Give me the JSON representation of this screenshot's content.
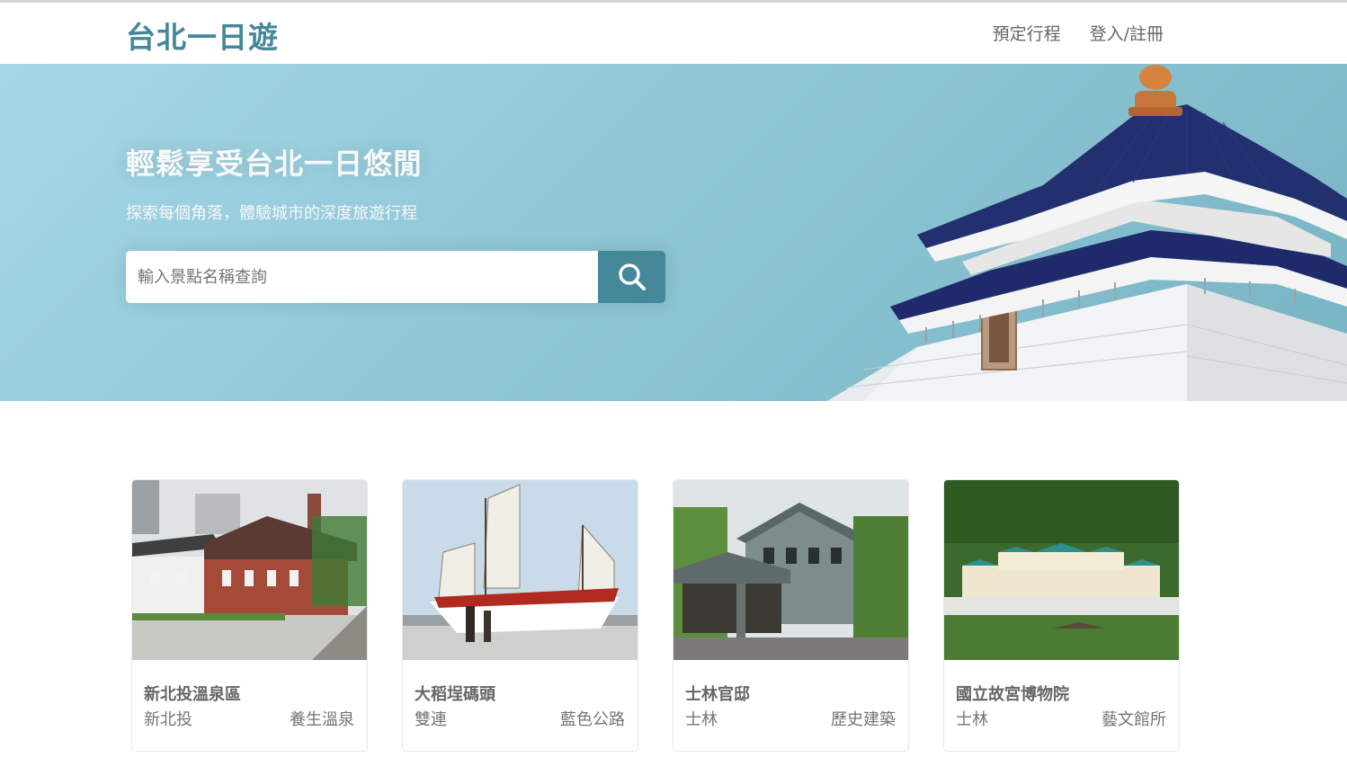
{
  "navbar": {
    "brand": "台北一日遊",
    "links": [
      "預定行程",
      "登入/註冊"
    ]
  },
  "hero": {
    "title": "輕鬆享受台北一日悠閒",
    "subtitle": "探索每個角落，體驗城市的深度旅遊行程",
    "search_placeholder": "輸入景點名稱查詢",
    "search_icon": "search-icon"
  },
  "attractions": [
    {
      "name": "新北投溫泉區",
      "mrt": "新北投",
      "category": "養生溫泉"
    },
    {
      "name": "大稻埕碼頭",
      "mrt": "雙連",
      "category": "藍色公路"
    },
    {
      "name": "士林官邸",
      "mrt": "士林",
      "category": "歷史建築"
    },
    {
      "name": "國立故宮博物院",
      "mrt": "士林",
      "category": "藝文館所"
    }
  ],
  "colors": {
    "brand": "#448899",
    "hero_start": "#a4d7e6",
    "hero_end": "#79b4c4",
    "text": "#666666"
  }
}
